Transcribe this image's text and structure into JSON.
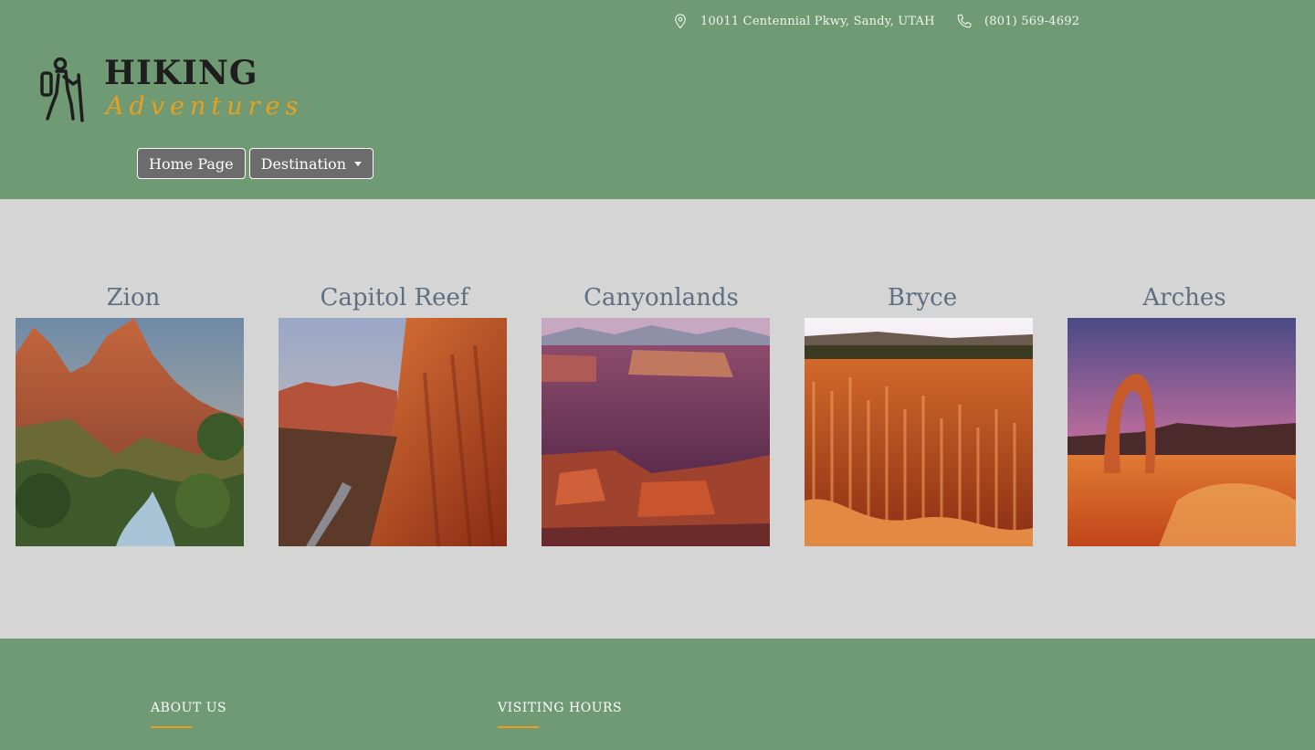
{
  "header": {
    "address": "10011 Centennial Pkwy, Sandy, UTAH",
    "phone": "(801) 569-4692",
    "address_icon": "map-pin-icon",
    "phone_icon": "phone-icon"
  },
  "logo": {
    "line1": "HIKING",
    "line2": "Adventures",
    "icon": "hiker-icon"
  },
  "nav": {
    "home_label": "Home Page",
    "destination_label": "Destination"
  },
  "parks": [
    {
      "name": "Zion"
    },
    {
      "name": "Capitol Reef"
    },
    {
      "name": "Canyonlands"
    },
    {
      "name": "Bryce"
    },
    {
      "name": "Arches"
    }
  ],
  "footer": {
    "about_heading": "ABOUT US",
    "hours_heading": "VISITING HOURS"
  },
  "colors": {
    "header_bg": "#6f9a73",
    "main_bg": "#d5d5d5",
    "accent": "#e8a01e",
    "heading": "#5f6f80"
  }
}
